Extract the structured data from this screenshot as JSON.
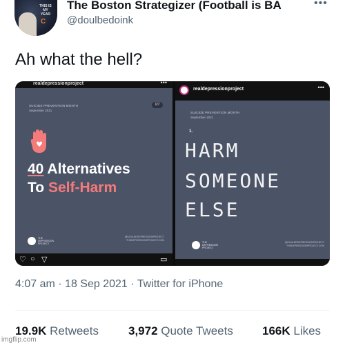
{
  "header": {
    "display_name": "The Boston Strategizer (Football is BA",
    "handle": "@doulbedoink",
    "more_icon": "ellipsis-icon",
    "avatar_text": "THIS IS MY YEAR",
    "avatar_logo": "C"
  },
  "tweet": {
    "text": "Ah what the hell?"
  },
  "media": {
    "left": {
      "account": "realdepressionproject",
      "month_label": "SUICIDE PREVENTION MONTH",
      "date_label": "September 2021",
      "counter": "1/7",
      "title_number": "40",
      "title_rest": " Alternatives",
      "title_line2_a": "To ",
      "title_line2_b": "Self-Harm",
      "brand": "THE DEPRESSION PROJECT",
      "credits_1": "@DOULBEDEPRESSIONPROJECT",
      "credits_2": "THEDEPRESSIONPROJECT.COM",
      "icons": [
        "heart-icon",
        "comment-icon",
        "send-icon",
        "bookmark-icon"
      ]
    },
    "right": {
      "account": "realdepressionproject",
      "month_label": "SUICIDE PREVENTION MONTH",
      "date_label": "September 2021",
      "number": "1.",
      "line1": "HARM",
      "line2": "SOMEONE",
      "line3": "ELSE",
      "brand": "THE DEPRESSION PROJECT",
      "credits_1": "@DOULBEDEPRESSIONPROJECT",
      "credits_2": "THEDEPRESSIONPROJECT.COM"
    }
  },
  "meta": {
    "time": "4:07 am",
    "date": "18 Sep 2021",
    "source": "Twitter for iPhone",
    "separator": "·"
  },
  "stats": {
    "retweets_count": "19.9K",
    "retweets_label": "Retweets",
    "quotes_count": "3,972",
    "quotes_label": "Quote Tweets",
    "likes_count": "166K",
    "likes_label": "Likes"
  },
  "watermark": "imgflip.com",
  "colors": {
    "panel_bg": "#4b5367",
    "accent_pink": "#f57b7b",
    "secondary_text": "#536471"
  }
}
